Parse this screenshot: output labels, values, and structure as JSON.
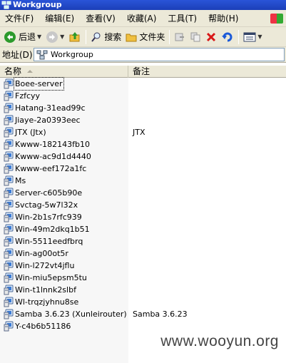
{
  "window": {
    "title": "Workgroup"
  },
  "menu": [
    "文件(F)",
    "编辑(E)",
    "查看(V)",
    "收藏(A)",
    "工具(T)",
    "帮助(H)"
  ],
  "toolbar": {
    "back_label": "后退",
    "search_label": "搜索",
    "folders_label": "文件夹"
  },
  "address": {
    "label": "地址(D)",
    "value": "Workgroup"
  },
  "columns": {
    "name": "名称",
    "comment": "备注"
  },
  "items": [
    {
      "name": "Boee-server",
      "comment": ""
    },
    {
      "name": "Fzfcyy",
      "comment": ""
    },
    {
      "name": "Hatang-31ead99c",
      "comment": ""
    },
    {
      "name": "Jiaye-2a0393eec",
      "comment": ""
    },
    {
      "name": "JTX (Jtx)",
      "comment": "JTX"
    },
    {
      "name": "Kwww-182143fb10",
      "comment": ""
    },
    {
      "name": "Kwww-ac9d1d4440",
      "comment": ""
    },
    {
      "name": "Kwww-eef172a1fc",
      "comment": ""
    },
    {
      "name": "Ms",
      "comment": ""
    },
    {
      "name": "Server-c605b90e",
      "comment": ""
    },
    {
      "name": "Svctag-5w7l32x",
      "comment": ""
    },
    {
      "name": "Win-2b1s7rfc939",
      "comment": ""
    },
    {
      "name": "Win-49m2dkq1b51",
      "comment": ""
    },
    {
      "name": "Win-5511eedfbrq",
      "comment": ""
    },
    {
      "name": "Win-ag00ot5r",
      "comment": ""
    },
    {
      "name": "Win-l272vt4jflu",
      "comment": ""
    },
    {
      "name": "Win-miu5epsm5tu",
      "comment": ""
    },
    {
      "name": "Win-t1lnnk2slbf",
      "comment": ""
    },
    {
      "name": "Wl-trqzjyhnu8se",
      "comment": ""
    },
    {
      "name": "Samba 3.6.23 (Xunleirouter)",
      "comment": "Samba 3.6.23"
    },
    {
      "name": "Y-c4b6b51186",
      "comment": ""
    }
  ],
  "watermark": "www.wooyun.org",
  "colors": {
    "titlebar": "#1b3fb8",
    "chrome": "#ece9d8",
    "back_arrow": "#2c9a2c",
    "delete_x": "#d81818"
  }
}
